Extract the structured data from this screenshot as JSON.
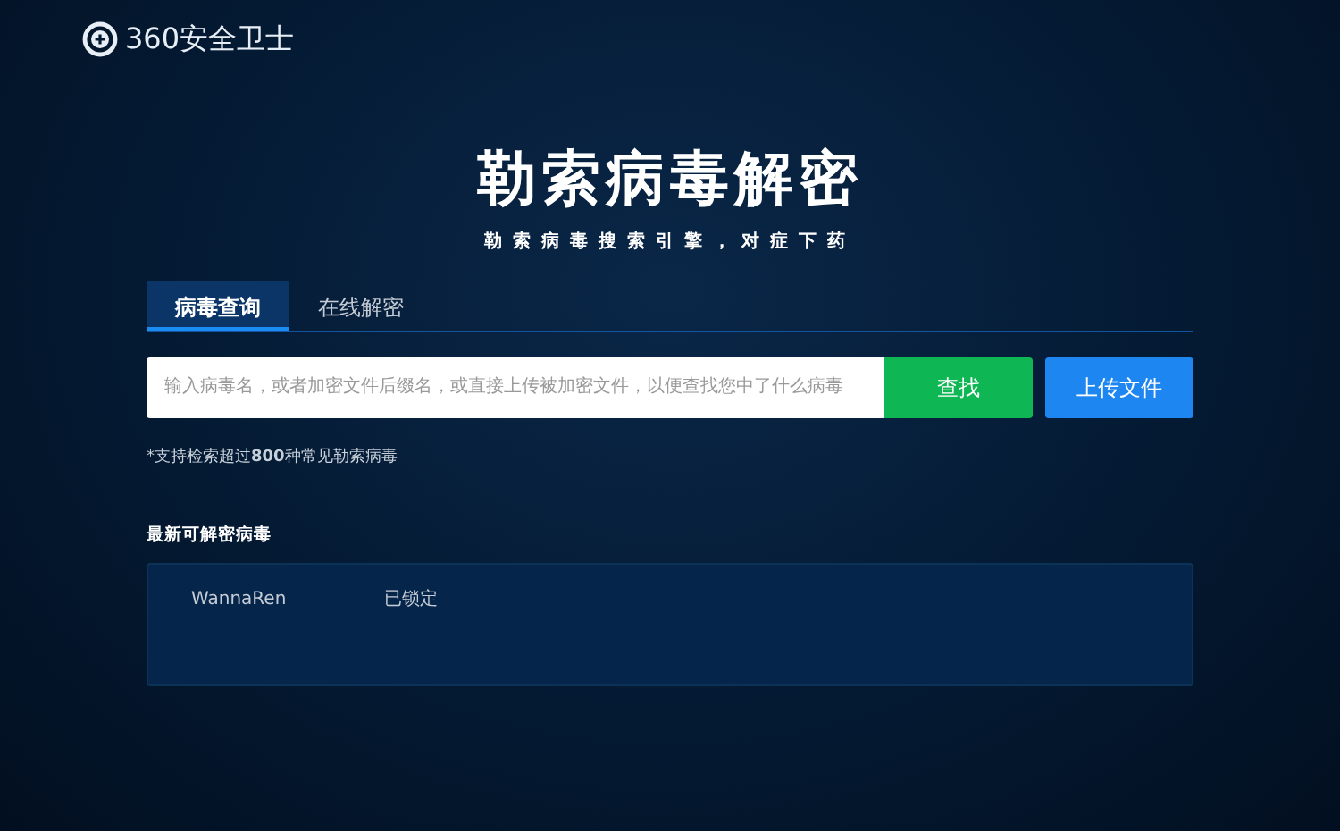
{
  "header": {
    "logo": "360安全卫士"
  },
  "hero": {
    "title": "勒索病毒解密",
    "subtitle": "勒索病毒搜索引擎，对症下药"
  },
  "tabs": [
    {
      "label": "病毒查询",
      "selected": true
    },
    {
      "label": "在线解密",
      "selected": false
    }
  ],
  "search": {
    "placeholder": "输入病毒名，或者加密文件后缀名，或直接上传被加密文件，以便查找您中了什么病毒",
    "buttons": [
      {
        "label": "查找",
        "kind": "search"
      },
      {
        "label": "上传文件",
        "kind": "upload"
      }
    ]
  },
  "note": "*支持检索超过**800**种常见勒索病毒",
  "latest": {
    "heading": "最新可解密病毒",
    "rows": [
      {
        "name": "WannaRen",
        "status": "已锁定"
      }
    ]
  }
}
